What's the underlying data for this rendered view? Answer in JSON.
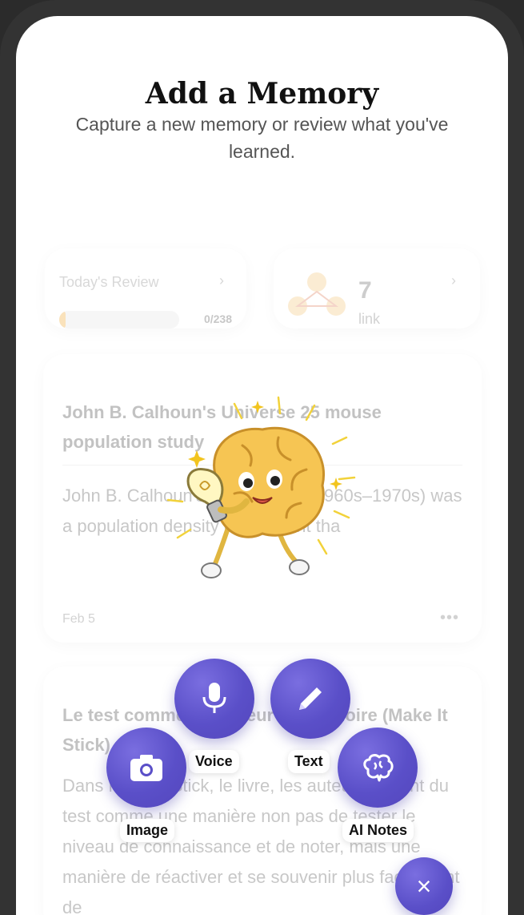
{
  "header": {
    "title": "Add a Memory",
    "subtitle": "Capture a new memory or review what you've learned."
  },
  "review": {
    "label": "Today's Review",
    "progress_text": "0/238",
    "progress_fraction": 0.0
  },
  "links": {
    "count": "7",
    "label": "link"
  },
  "notes": [
    {
      "title": "John B. Calhoun's Universe 25 mouse population study",
      "body": "John B. Calhoun's Universe 25 (1960s–1970s) was a population density experiment tha",
      "date": "Feb 5",
      "more": "•••"
    },
    {
      "title": "Le test comme activateur de mémoire (Make It Stick)",
      "body": "Dans Make It Stick, le livre, les auteurs parlent du test comme une manière non pas de tester le niveau de connaissance et de noter, mais une manière de réactiver et se souvenir plus facilement de"
    }
  ],
  "actions": {
    "voice": "Voice",
    "text": "Text",
    "image": "Image",
    "ai_notes": "AI Notes",
    "close": "×"
  },
  "colors": {
    "fab": "#5a4fc8",
    "progress": "#f0a830"
  },
  "icons": {
    "voice": "microphone-icon",
    "text": "pencil-icon",
    "image": "camera-icon",
    "ai_notes": "brain-icon",
    "close": "close-icon",
    "review": "chevron-right-icon"
  }
}
